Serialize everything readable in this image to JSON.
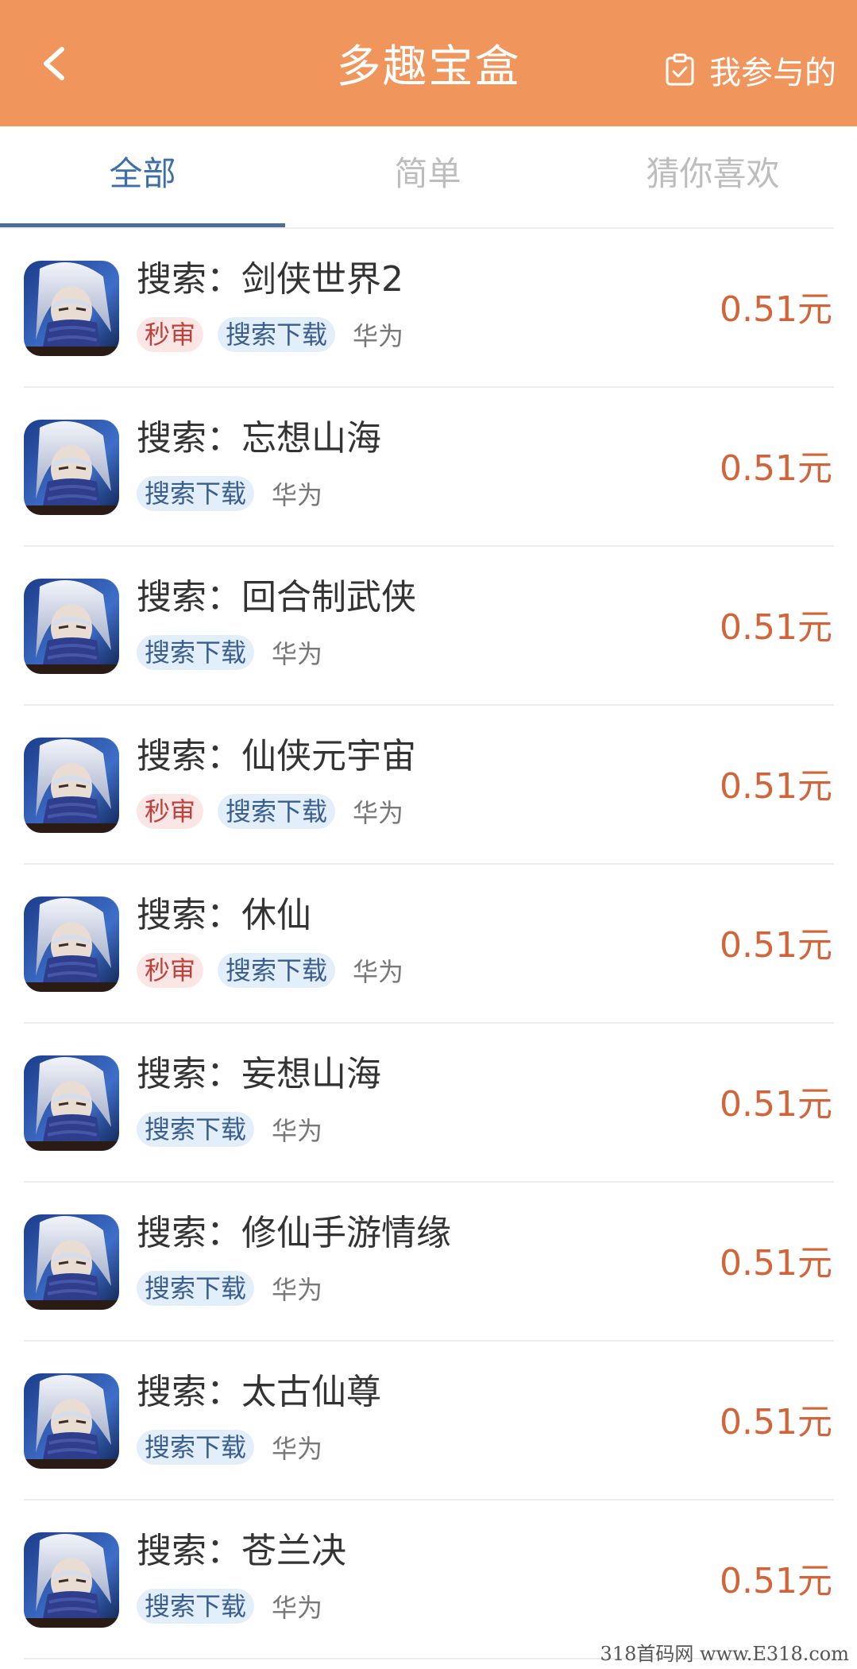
{
  "header": {
    "title": "多趣宝盒",
    "participated_label": "我参与的",
    "bg_color": "#F0955C"
  },
  "tabs": [
    {
      "label": "全部",
      "active": true
    },
    {
      "label": "简单",
      "active": false
    },
    {
      "label": "猜你喜欢",
      "active": false
    }
  ],
  "tasks": [
    {
      "title": "搜索：剑侠世界2",
      "fast_tag": "秒审",
      "search_tag": "搜索下载",
      "platform": "华为",
      "price": "0.51元"
    },
    {
      "title": "搜索：忘想山海",
      "fast_tag": "",
      "search_tag": "搜索下载",
      "platform": "华为",
      "price": "0.51元"
    },
    {
      "title": "搜索：回合制武侠",
      "fast_tag": "",
      "search_tag": "搜索下载",
      "platform": "华为",
      "price": "0.51元"
    },
    {
      "title": "搜索：仙侠元宇宙",
      "fast_tag": "秒审",
      "search_tag": "搜索下载",
      "platform": "华为",
      "price": "0.51元"
    },
    {
      "title": "搜索：休仙",
      "fast_tag": "秒审",
      "search_tag": "搜索下载",
      "platform": "华为",
      "price": "0.51元"
    },
    {
      "title": "搜索：妄想山海",
      "fast_tag": "",
      "search_tag": "搜索下载",
      "platform": "华为",
      "price": "0.51元"
    },
    {
      "title": "搜索：修仙手游情缘",
      "fast_tag": "",
      "search_tag": "搜索下载",
      "platform": "华为",
      "price": "0.51元"
    },
    {
      "title": "搜索：太古仙尊",
      "fast_tag": "",
      "search_tag": "搜索下载",
      "platform": "华为",
      "price": "0.51元"
    },
    {
      "title": "搜索：苍兰决",
      "fast_tag": "",
      "search_tag": "搜索下载",
      "platform": "华为",
      "price": "0.51元"
    }
  ],
  "watermark": "318首码网 www.E318.com"
}
